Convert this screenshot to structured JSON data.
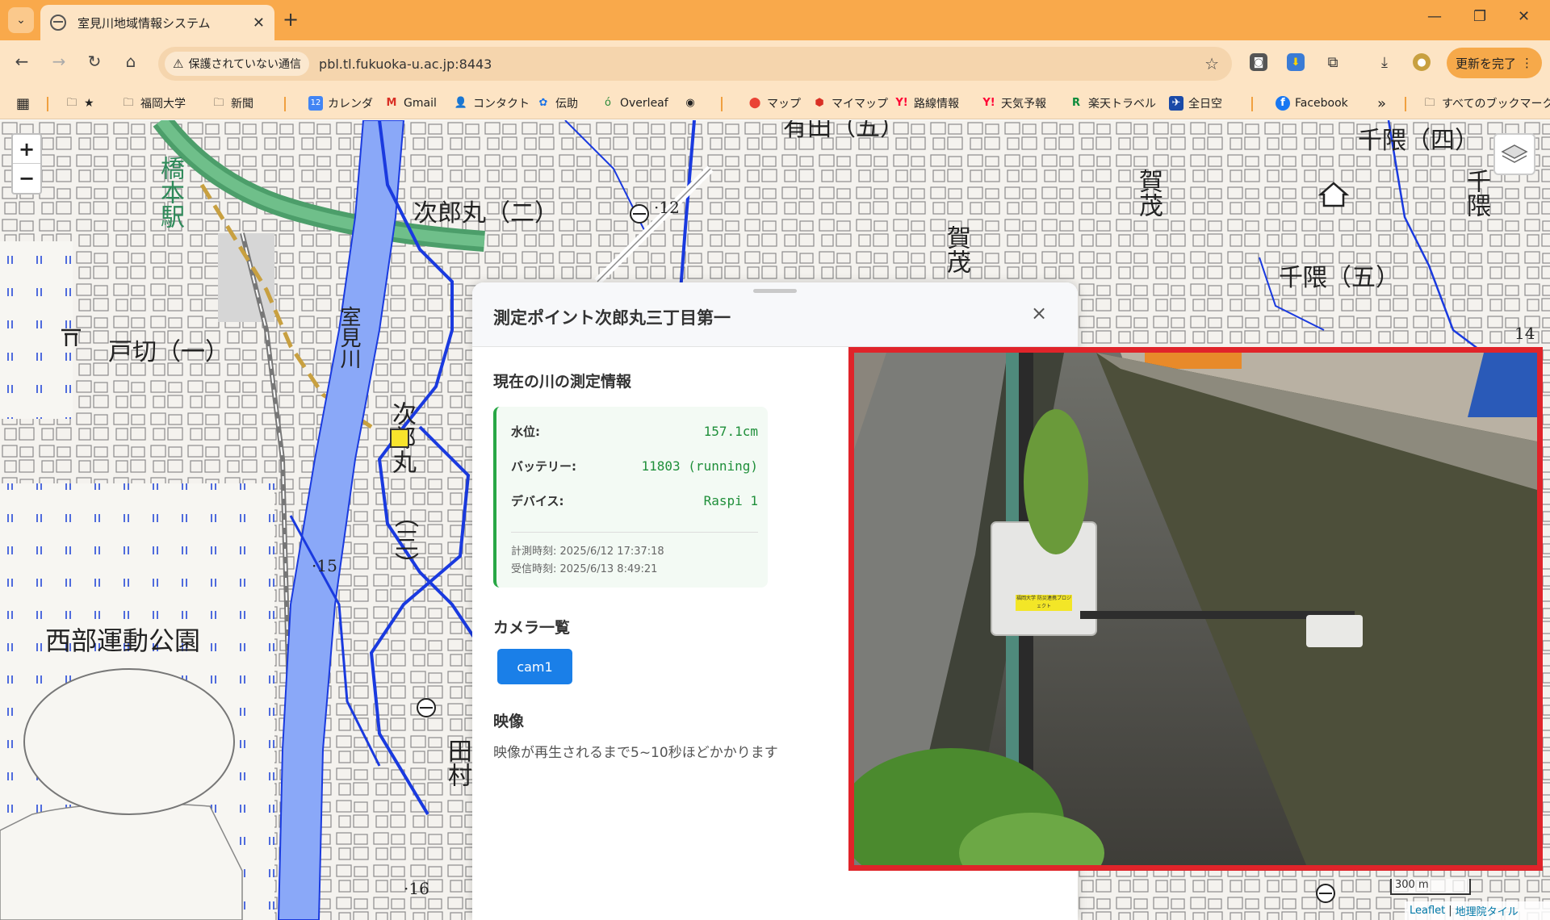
{
  "browser": {
    "tab_title": "室見川地域情報システム",
    "security_label": "保護されていない通信",
    "url": "pbl.tl.fukuoka-u.ac.jp:8443",
    "update_label": "更新を完了"
  },
  "bookmarks": {
    "items": [
      "福岡大学",
      "新聞",
      "カレンダ",
      "Gmail",
      "コンタクト",
      "伝助",
      "Overleaf",
      "マップ",
      "マイマップ",
      "路線情報",
      "天気予報",
      "楽天トラベル",
      "全日空",
      "Facebook"
    ],
    "all_label": "すべてのブックマーク",
    "more": "»"
  },
  "map": {
    "labels": [
      "次郎丸（二）",
      "戸切（一）",
      "西部運動公園",
      "千隈（四）",
      "千隈（五）",
      "賀茂",
      "賀茂",
      "橋本駅",
      "室見川",
      "次郎丸",
      "（三）",
      "千隈",
      "有田（五）",
      "田村",
      "·12",
      "·15",
      "·16",
      "14"
    ],
    "scale_label": "300 m",
    "attribution": {
      "leaflet": "Leaflet",
      "sep": "|",
      "tiles": "地理院タイル"
    },
    "colors": {
      "river": "#1a3adf",
      "road": "#4c9e6a"
    }
  },
  "panel": {
    "title": "測定ポイント次郎丸三丁目第一",
    "close": "×",
    "measure_section": "現在の川の測定情報",
    "rows": [
      {
        "label": "水位:",
        "value": "157.1cm"
      },
      {
        "label": "バッテリー:",
        "value": "11803 (running)"
      },
      {
        "label": "デバイス:",
        "value": "Raspi 1"
      }
    ],
    "measured_at": "計測時刻: 2025/6/12 17:37:18",
    "received_at": "受信時刻: 2025/6/13 8:49:21",
    "camera_section": "カメラ一覧",
    "camera_button": "cam1",
    "video_section": "映像",
    "video_note": "映像が再生されるまで5~10秒ほどかかります"
  },
  "video": {
    "sticker_text": "福岡大学 防災連携プロジェクト"
  }
}
